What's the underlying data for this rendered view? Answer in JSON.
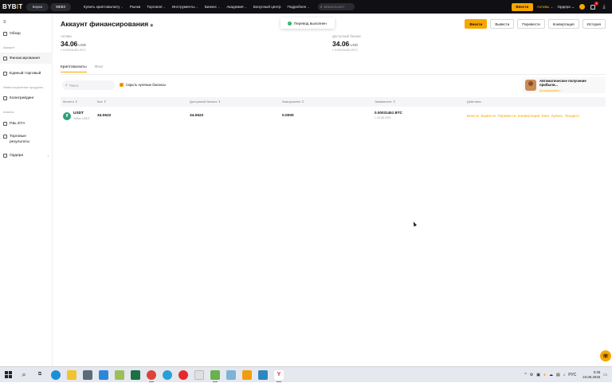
{
  "topnav": {
    "logo_main": "BYB",
    "logo_dot": "I",
    "logo_end": "T",
    "exchange_pill": "Биржа",
    "web3_pill": "WEB3",
    "items": [
      {
        "label": "Купить криптовалюту",
        "chev": true
      },
      {
        "label": "Рынки",
        "chev": false
      },
      {
        "label": "Торговля",
        "chev": true
      },
      {
        "label": "Инструменты",
        "chev": true
      },
      {
        "label": "Бизнес",
        "chev": true
      },
      {
        "label": "Академия",
        "chev": true
      },
      {
        "label": "Бонусный центр",
        "chev": false
      },
      {
        "label": "Подробнее",
        "chev": true
      }
    ],
    "search_placeholder": "BINDEXUSDT",
    "deposit": "Внести",
    "assets": "Активы",
    "orders": "Ордера",
    "notif_count": "1"
  },
  "sidebar": {
    "toggle": "≡",
    "overview": "Обзор",
    "section_account": "Аккаунт",
    "funding": "Финансирования",
    "unified": "Единый торговый",
    "section_invest": "Инвестиционные продукты",
    "copytrading": "Копитрейдинг",
    "section_analysis": "Анализ",
    "pnl": "P&L ЕТА",
    "trade_results_1": "Торговые",
    "trade_results_2": "результаты",
    "orders": "Ордера"
  },
  "main": {
    "title": "Аккаунт финансирования",
    "buttons": {
      "deposit": "Внести",
      "withdraw": "Вывести",
      "transfer": "Перевести",
      "convert": "Конвертация",
      "history": "История"
    },
    "assets_label": "Активы",
    "assets_value": "34.06",
    "assets_currency": "USD",
    "assets_sub": "≈ 0.00031451 BTC",
    "available_label": "Доступный баланс",
    "available_value": "34.06",
    "available_currency": "USD",
    "available_sub": "≈ 0.00031451 BTC",
    "tabs": [
      "Криптовалюты",
      "Фиат"
    ],
    "search_placeholder": "Поиск",
    "hide_zero": "Скрыть нулевые балансы",
    "promo_title": "Автоматическое получение прибыли...",
    "promo_link": "Активировать  ›",
    "columns": [
      "Монета ⇕",
      "Все ⇕",
      "Доступный баланс ⇕",
      "Заморожено ⇕",
      "Эквивалент ⇕",
      "Действия"
    ],
    "rows": [
      {
        "coin": "USDT",
        "coin_full": "Tether USDT",
        "total": "34.0622",
        "available": "34.0622",
        "frozen": "0.0000",
        "equivalent": "0.00031451 BTC",
        "equivalent_sub": "≈ 34.06 USD",
        "actions": [
          "Внести",
          "Вывести",
          "Перевести",
          "Конвертация",
          "Earn",
          "Купить",
          "Продать"
        ]
      }
    ]
  },
  "toast": {
    "text": "Перевод выполнен"
  },
  "taskbar": {
    "lang": "РУС",
    "time": "0:35",
    "date": "24.05.2025"
  },
  "colors": {
    "accent": "#f7a600",
    "nav_bg": "#101014",
    "success": "#20b26c",
    "usdt": "#26a17b"
  }
}
